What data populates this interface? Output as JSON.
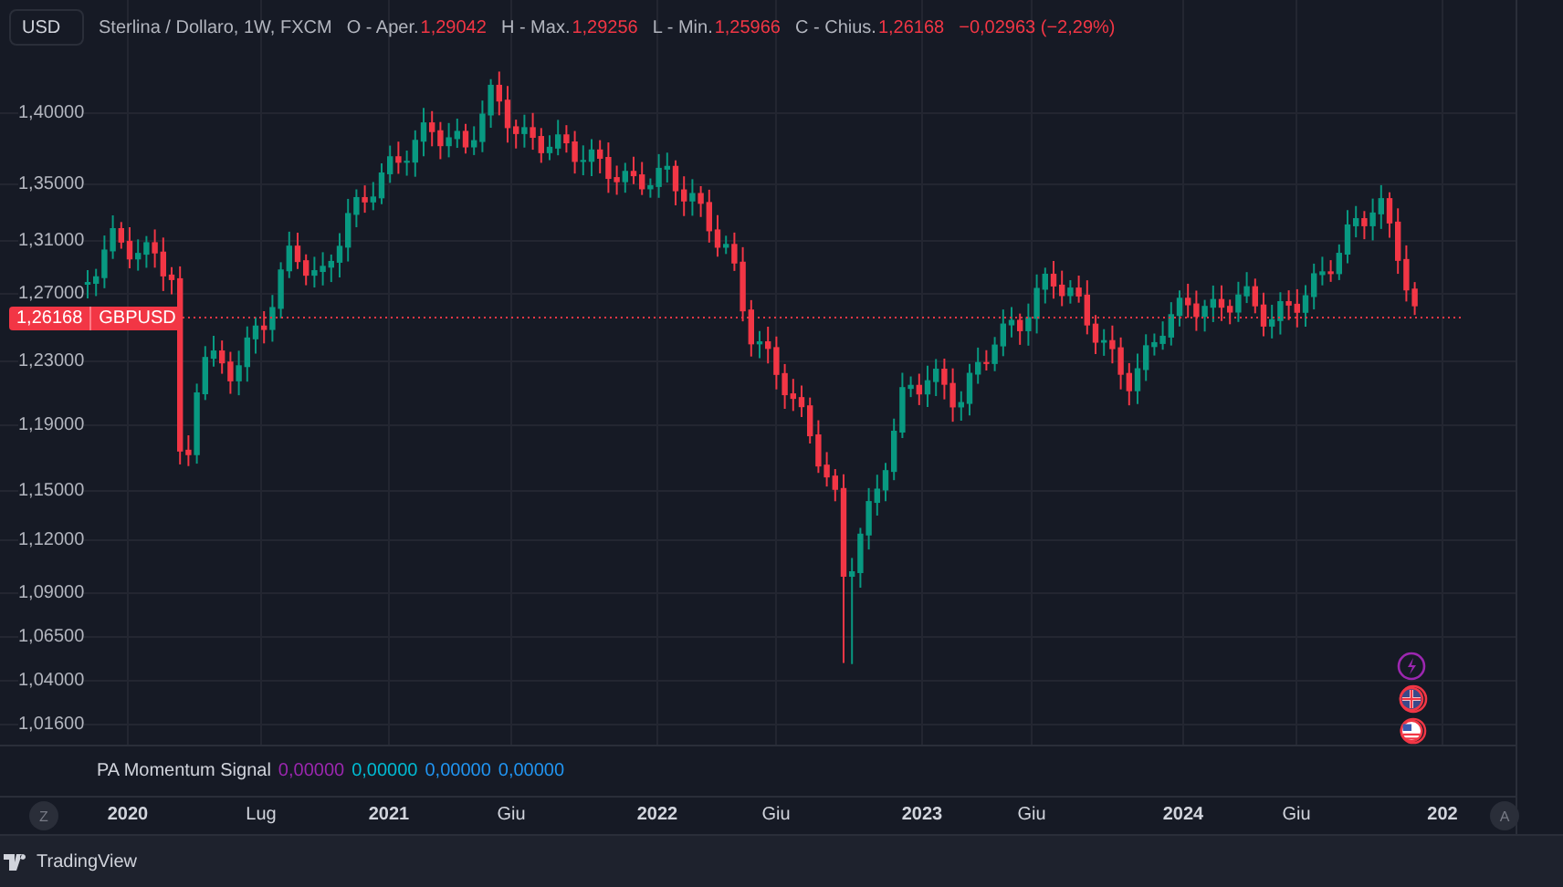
{
  "legend": {
    "currency_button": "USD",
    "title": "Sterlina / Dollaro, 1W, FXCM",
    "ohlc": [
      {
        "label": "O - Aper.",
        "value": "1,29042"
      },
      {
        "label": "H - Max.",
        "value": "1,29256"
      },
      {
        "label": "L - Min.",
        "value": "1,25966"
      },
      {
        "label": "C - Chius.",
        "value": "1,26168"
      }
    ],
    "change": "−0,02963 (−2,29%)"
  },
  "price_axis": [
    "1,40000",
    "1,35000",
    "1,31000",
    "1,27000",
    "1,23000",
    "1,19000",
    "1,15000",
    "1,12000",
    "1,09000",
    "1,06500",
    "1,04000",
    "1,01600"
  ],
  "last_price": {
    "value": "1,26168",
    "symbol": "GBPUSD"
  },
  "indicator": {
    "name": "PA Momentum Signal",
    "values": [
      {
        "text": "0,00000",
        "color": "#9c27b0"
      },
      {
        "text": "0,00000",
        "color": "#00bcd4"
      },
      {
        "text": "0,00000",
        "color": "#2196f3"
      },
      {
        "text": "0,00000",
        "color": "#2196f3"
      }
    ]
  },
  "time_axis": {
    "zoom_button": "Z",
    "auto_button": "A",
    "labels": [
      {
        "text": "2020",
        "kind": "year"
      },
      {
        "text": "Lug",
        "kind": "month"
      },
      {
        "text": "2021",
        "kind": "year"
      },
      {
        "text": "Giu",
        "kind": "month"
      },
      {
        "text": "2022",
        "kind": "year"
      },
      {
        "text": "Giu",
        "kind": "month"
      },
      {
        "text": "2023",
        "kind": "year"
      },
      {
        "text": "Giu",
        "kind": "month"
      },
      {
        "text": "2024",
        "kind": "year"
      },
      {
        "text": "Giu",
        "kind": "month"
      },
      {
        "text": "202",
        "kind": "year"
      }
    ]
  },
  "footer": {
    "brand": "TradingView"
  }
}
